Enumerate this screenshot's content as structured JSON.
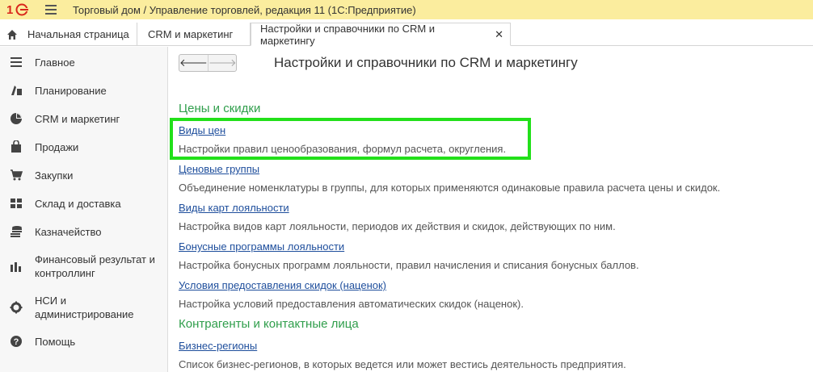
{
  "titlebar": {
    "title": "Торговый дом / Управление торговлей, редакция 11  (1С:Предприятие)"
  },
  "tabs": [
    {
      "label": "Начальная страница",
      "icon": "home-icon"
    },
    {
      "label": "CRM и маркетинг"
    },
    {
      "label": "Настройки и справочники по CRM и маркетингу",
      "close": "✕",
      "active": true
    }
  ],
  "sidebar": {
    "items": [
      {
        "label": "Главное",
        "icon": "hamburger-icon"
      },
      {
        "label": "Планирование",
        "icon": "planning-icon"
      },
      {
        "label": "CRM и маркетинг",
        "icon": "pie-chart-icon"
      },
      {
        "label": "Продажи",
        "icon": "shopping-bag-icon"
      },
      {
        "label": "Закупки",
        "icon": "cart-icon"
      },
      {
        "label": "Склад и доставка",
        "icon": "warehouse-icon"
      },
      {
        "label": "Казначейство",
        "icon": "coins-icon"
      },
      {
        "label": "Финансовый результат и контроллинг",
        "icon": "bar-chart-icon"
      },
      {
        "label": "НСИ и администрирование",
        "icon": "gear-icon"
      },
      {
        "label": "Помощь",
        "icon": "help-icon"
      }
    ]
  },
  "nav": {
    "back": "🡐",
    "forward": "🡒"
  },
  "page": {
    "title": "Настройки и справочники по CRM и маркетингу"
  },
  "sections": [
    {
      "title": "Цены и скидки",
      "entries": [
        {
          "link": "Виды цен",
          "desc": "Настройки правил ценообразования, формул расчета, округления."
        },
        {
          "link": "Ценовые группы",
          "desc": "Объединение номенклатуры в группы, для которых применяются одинаковые правила расчета цены и скидок."
        },
        {
          "link": "Виды карт лояльности",
          "desc": "Настройка видов карт лояльности, периодов их действия и скидок, действующих по ним."
        },
        {
          "link": "Бонусные программы лояльности",
          "desc": "Настройка бонусных программ лояльности, правил начисления и списания бонусных баллов."
        },
        {
          "link": "Условия предоставления скидок (наценок)",
          "desc": "Настройка условий предоставления автоматических скидок (наценок)."
        }
      ]
    },
    {
      "title": "Контрагенты и контактные лица",
      "entries": [
        {
          "link": "Бизнес-регионы",
          "desc": "Список бизнес-регионов, в которых ведется или может вестись деятельность предприятия."
        }
      ]
    }
  ],
  "colors": {
    "titlebar_bg": "#fbed9e",
    "section_title": "#2f9e4b",
    "link": "#1e4e9c",
    "highlight": "#22e01a",
    "logo_red": "#d9261c"
  }
}
